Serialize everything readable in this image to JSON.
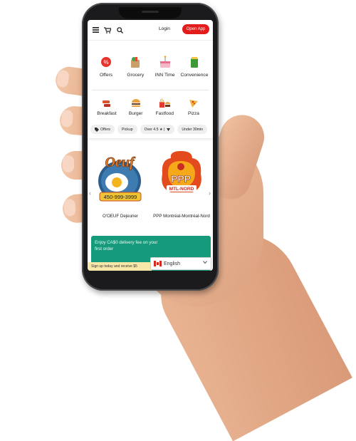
{
  "header": {
    "icons": [
      "menu-icon",
      "cart-icon",
      "search-icon"
    ],
    "login_label": "Login",
    "open_app_label": "Open App",
    "accent_color": "#e21b1b"
  },
  "categories_row1": [
    {
      "label": "Offers",
      "icon": "offers-icon"
    },
    {
      "label": "Grocery",
      "icon": "grocery-icon"
    },
    {
      "label": "INN Time",
      "icon": "inn-time-icon"
    },
    {
      "label": "Convenience",
      "icon": "convenience-icon"
    }
  ],
  "categories_row2": [
    {
      "label": "Breakfast",
      "icon": "breakfast-icon"
    },
    {
      "label": "Burger",
      "icon": "burger-icon"
    },
    {
      "label": "Fastfood",
      "icon": "fastfood-icon"
    },
    {
      "label": "Pizza",
      "icon": "pizza-icon"
    }
  ],
  "filters": [
    "Offers",
    "Pickup",
    "Over 4.5 ★ |",
    "Under 30min"
  ],
  "restaurants": [
    {
      "name": "O'OEUF Dejeuner",
      "logo_text": "Oeuf",
      "logo_phone": "450-999-3999"
    },
    {
      "name": "PPP Montréal-Montréal-Nord",
      "logo_text": "PPP",
      "logo_sub": "MTL-NORD"
    }
  ],
  "promo": {
    "text": "Enjoy CA$0 delivery fee on your first order",
    "signup_text": "Sign up today and receive $5",
    "color": "#159a7c"
  },
  "language": {
    "selected": "English",
    "flag": "canada-flag-icon"
  }
}
